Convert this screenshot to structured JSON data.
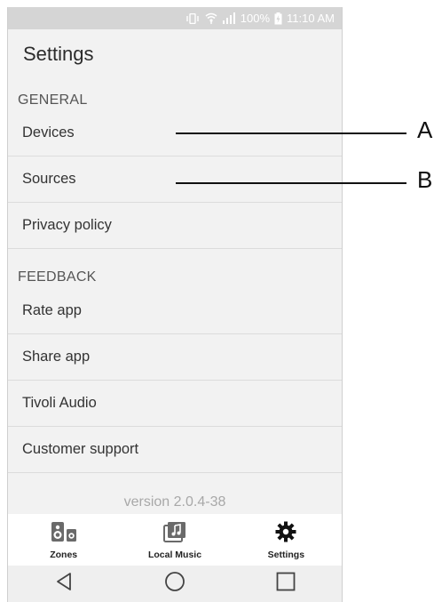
{
  "status_bar": {
    "battery": "100%",
    "time": "11:10 AM",
    "icons": [
      "vibrate-icon",
      "wifi-icon",
      "signal-icon",
      "battery-icon"
    ]
  },
  "header": {
    "title": "Settings"
  },
  "general": {
    "heading": "GENERAL",
    "items": [
      {
        "label": "Devices"
      },
      {
        "label": "Sources"
      },
      {
        "label": "Privacy policy"
      }
    ]
  },
  "feedback": {
    "heading": "FEEDBACK",
    "items": [
      {
        "label": "Rate app"
      },
      {
        "label": "Share app"
      },
      {
        "label": "Tivoli Audio"
      },
      {
        "label": "Customer support"
      }
    ]
  },
  "version": "version 2.0.4-38",
  "tabs": [
    {
      "label": "Zones",
      "icon": "speaker-icon"
    },
    {
      "label": "Local Music",
      "icon": "music-library-icon"
    },
    {
      "label": "Settings",
      "icon": "gear-icon"
    }
  ],
  "nav": {
    "buttons": [
      "back-icon",
      "home-icon",
      "recents-icon"
    ]
  },
  "callouts": {
    "a": "A",
    "b": "B"
  }
}
